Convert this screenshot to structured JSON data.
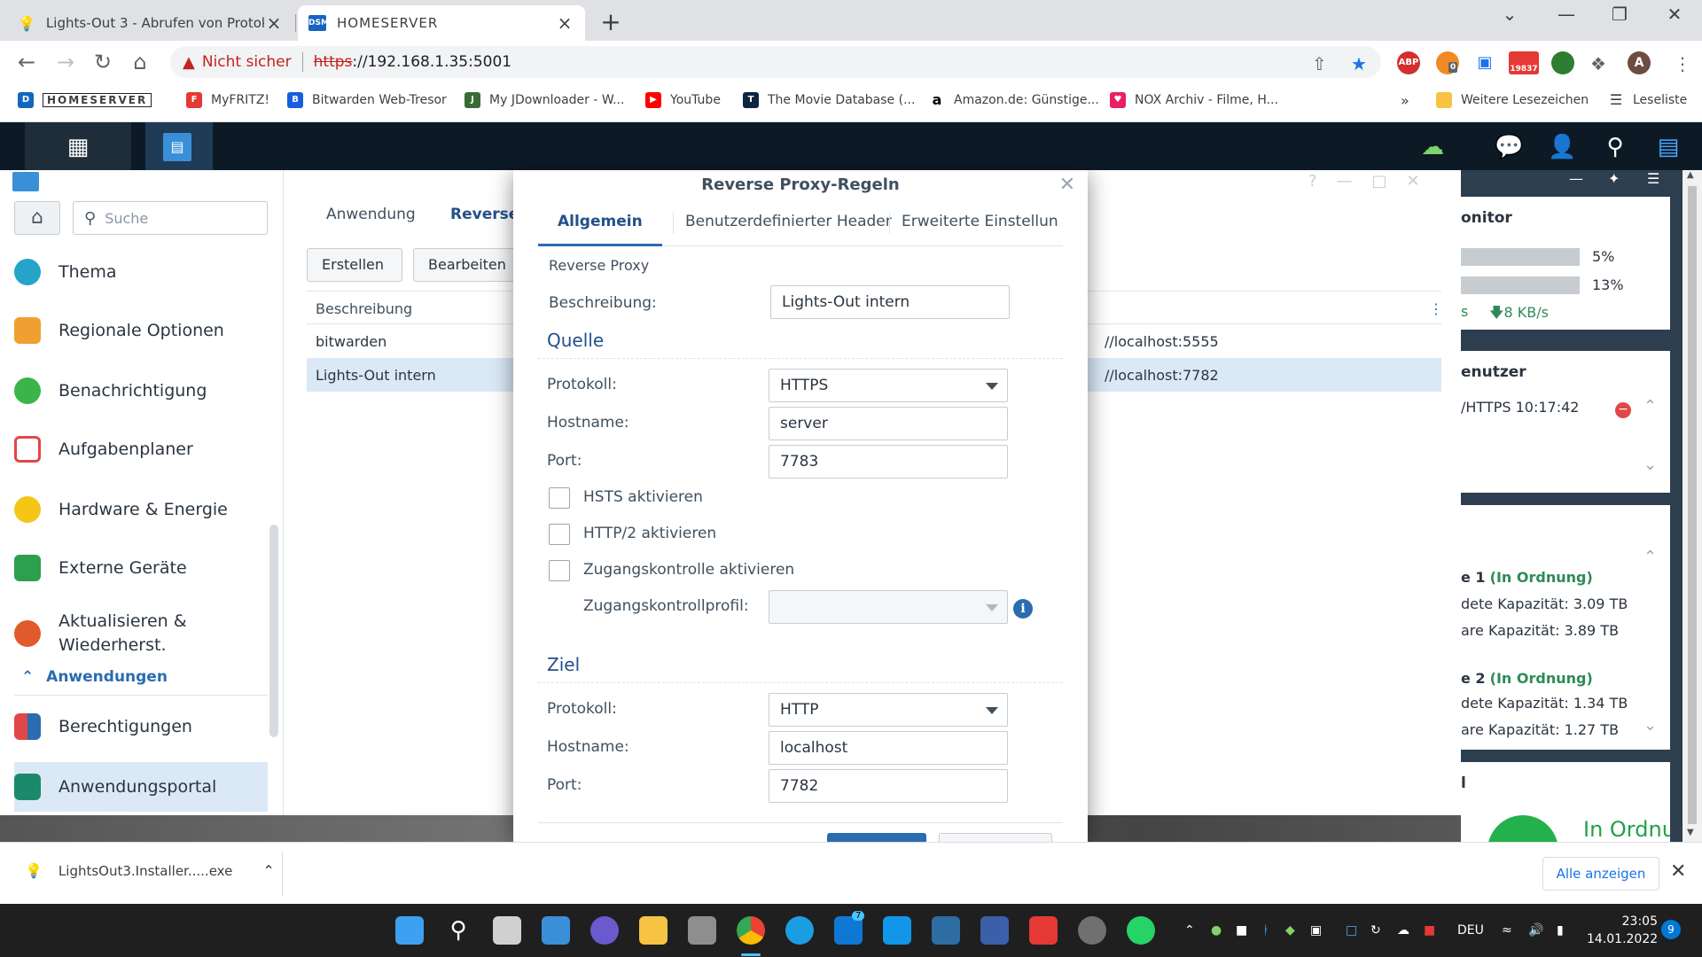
{
  "browser": {
    "tabs": [
      {
        "title": "Lights-Out 3 - Abrufen von Protokol",
        "active": false
      },
      {
        "title": "HOMESERVER",
        "active": true
      }
    ],
    "address": {
      "warning": "Nicht sicher",
      "scheme": "https",
      "rest": "://192.168.1.35:5001"
    },
    "extensions": {
      "mail_count": "19837",
      "badge0": "0"
    },
    "bookmarks": [
      {
        "label": "HOMESERVER"
      },
      {
        "label": "MyFRITZ!"
      },
      {
        "label": "Bitwarden Web-Tresor"
      },
      {
        "label": "My JDownloader - W..."
      },
      {
        "label": "YouTube"
      },
      {
        "label": "The Movie Database (..."
      },
      {
        "label": "Amazon.de: Günstige..."
      },
      {
        "label": "NOX Archiv - Filme, H..."
      }
    ],
    "bookmarks_more": "»",
    "other_bookmarks": "Weitere Lesezeichen",
    "reading_list": "Leseliste"
  },
  "control_panel": {
    "search_placeholder": "Suche",
    "sidebar": [
      {
        "label": "Thema",
        "color": "#26a3c9"
      },
      {
        "label": "Regionale Optionen",
        "color": "#f0a030"
      },
      {
        "label": "Benachrichtigung",
        "color": "#3bb54a"
      },
      {
        "label": "Aufgabenplaner",
        "color": "#e04848"
      },
      {
        "label": "Hardware & Energie",
        "color": "#f5c518"
      },
      {
        "label": "Externe Geräte",
        "color": "#2e9e4f"
      },
      {
        "label": "Aktualisieren &",
        "label2": "Wiederherst.",
        "color": "#e05a2b"
      },
      {
        "label": "Berechtigungen",
        "color": "#e04848"
      },
      {
        "label": "Anwendungsportal",
        "color": "#1b8a6b"
      }
    ],
    "category": "Anwendungen",
    "tabs": [
      "Anwendung",
      "Reverse"
    ],
    "buttons": [
      "Erstellen",
      "Bearbeiten"
    ],
    "grid_header": "Beschreibung",
    "rows": [
      {
        "desc": "bitwarden",
        "target": "//localhost:5555"
      },
      {
        "desc": "Lights-Out intern",
        "target": "//localhost:7782"
      }
    ]
  },
  "widgets": {
    "monitor_title": "onitor",
    "cpu": "5%",
    "ram": "13%",
    "net_left": "s",
    "net_down": "8 KB/s",
    "users_title": "enutzer",
    "user_row": "/HTTPS 10:17:42",
    "vol1_title": "e 1",
    "vol1_status": "(In Ordnung)",
    "vol1_used": "dete Kapazität: 3.09 TB",
    "vol1_free": "are Kapazität: 3.89 TB",
    "vol2_title": "e 2",
    "vol2_status": "(In Ordnung)",
    "vol2_used": "dete Kapazität: 1.34 TB",
    "vol2_free": "are Kapazität: 1.27 TB",
    "health_title": "l",
    "health_status": "In Ordnung"
  },
  "dialog": {
    "title": "Reverse Proxy-Regeln",
    "tabs": [
      "Allgemein",
      "Benutzerdefinierter Header",
      "Erweiterte Einstellun"
    ],
    "section_top": "Reverse Proxy",
    "description_label": "Beschreibung:",
    "description_value": "Lights-Out intern",
    "source": {
      "title": "Quelle",
      "protocol_label": "Protokoll:",
      "protocol": "HTTPS",
      "hostname_label": "Hostname:",
      "hostname": "server",
      "port_label": "Port:",
      "port": "7783"
    },
    "checkboxes": [
      {
        "label": "HSTS aktivieren",
        "checked": false
      },
      {
        "label": "HTTP/2 aktivieren",
        "checked": false
      },
      {
        "label": "Zugangskontrolle aktivieren",
        "checked": false
      }
    ],
    "access_profile_label": "Zugangskontrollprofil:",
    "target": {
      "title": "Ziel",
      "protocol_label": "Protokoll:",
      "protocol": "HTTP",
      "hostname_label": "Hostname:",
      "hostname": "localhost",
      "port_label": "Port:",
      "port": "7782"
    }
  },
  "download": {
    "file": "LightsOut3.Installer.....exe",
    "show_all": "Alle anzeigen"
  },
  "taskbar": {
    "lang": "DEU",
    "time": "23:05",
    "date": "14.01.2022",
    "mail_badge": "7",
    "notif_badge": "9"
  }
}
